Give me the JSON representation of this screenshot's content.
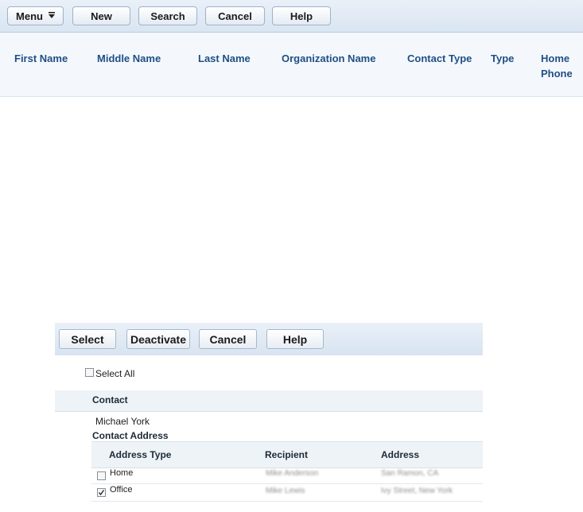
{
  "toolbar": {
    "menu_label": "Menu",
    "new_label": "New",
    "search_label": "Search",
    "cancel_label": "Cancel",
    "help_label": "Help"
  },
  "results_table": {
    "columns": [
      "First Name",
      "Middle Name",
      "Last Name",
      "Organization Name",
      "Contact Type",
      "Type",
      "Home",
      "Phone"
    ]
  },
  "dialog": {
    "buttons": {
      "select": "Select",
      "deactivate": "Deactivate",
      "cancel": "Cancel",
      "help": "Help"
    },
    "select_all_label": "Select All",
    "contact_header": "Contact",
    "contact_name": "Michael York",
    "contact_address_header": "Contact Address",
    "address_columns": [
      "Address Type",
      "Recipient",
      "Address"
    ],
    "address_rows": [
      {
        "type": "Home",
        "checked": false,
        "recipient": "Mike Anderson",
        "address": "San Ramon, CA"
      },
      {
        "type": "Office",
        "checked": true,
        "recipient": "Mike Lewis",
        "address": "Ivy Street, New York"
      }
    ]
  }
}
